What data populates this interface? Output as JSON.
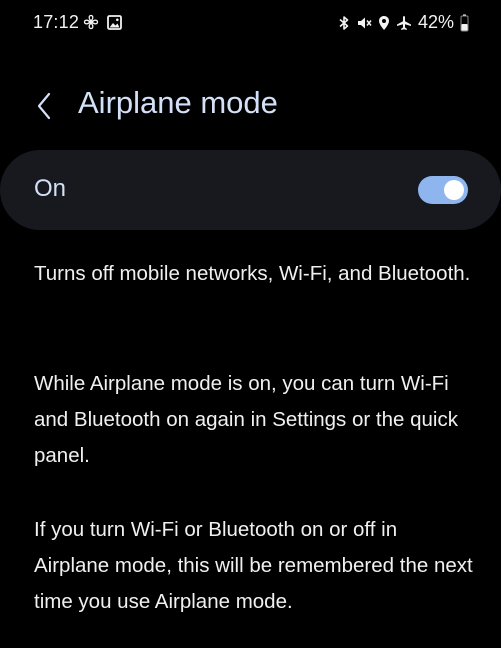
{
  "status_bar": {
    "time": "17:12",
    "battery_percent": "42%",
    "left_icons": [
      "fan-icon",
      "gallery-icon"
    ],
    "right_icons": [
      "bluetooth-icon",
      "mute-icon",
      "location-icon",
      "airplane-icon",
      "battery-icon"
    ]
  },
  "header": {
    "title": "Airplane mode",
    "back_icon": "chevron-left-icon"
  },
  "toggle": {
    "label": "On",
    "state": true,
    "accent_color": "#8fb5ef"
  },
  "description": {
    "paragraph_1": "Turns off mobile networks, Wi-Fi, and Bluetooth.",
    "paragraph_2": "While Airplane mode is on, you can turn Wi-Fi and Bluetooth on again in Settings or the quick panel.",
    "paragraph_3": "If you turn Wi-Fi or Bluetooth on or off in Airplane mode, this will be remembered the next time you use Airplane mode."
  }
}
